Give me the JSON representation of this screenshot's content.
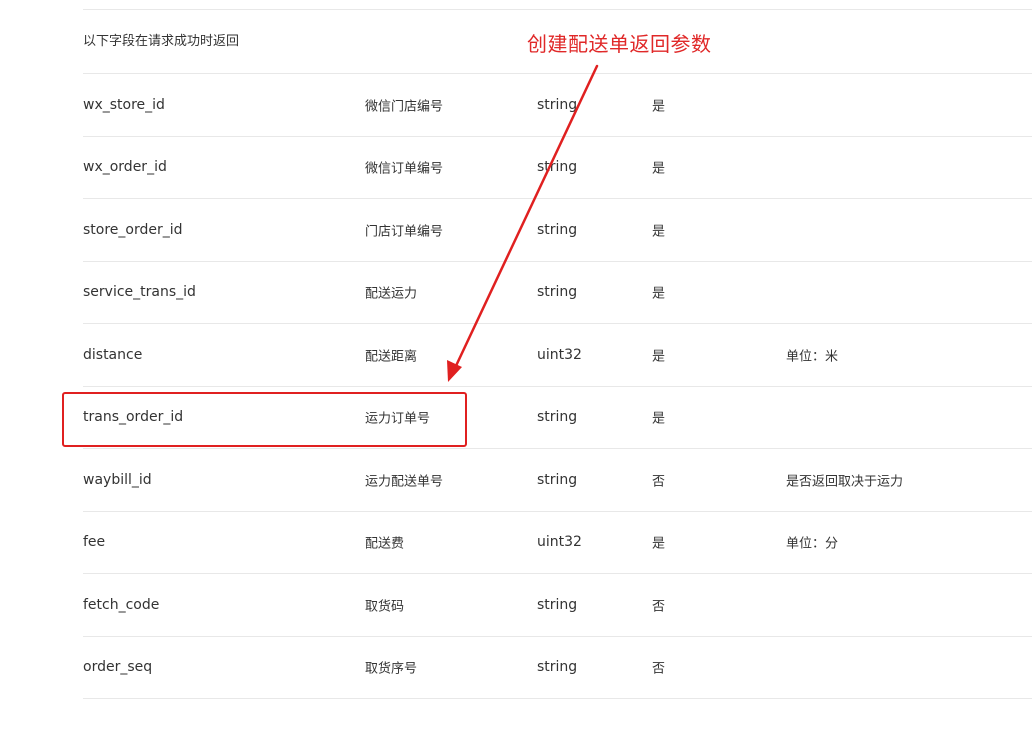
{
  "section": {
    "intro": "以下字段在请求成功时返回"
  },
  "annotation": {
    "title": "创建配送单返回参数",
    "color": "#e02020"
  },
  "rows": [
    {
      "name": "wx_store_id",
      "desc": "微信门店编号",
      "type": "string",
      "required": "是",
      "note": ""
    },
    {
      "name": "wx_order_id",
      "desc": "微信订单编号",
      "type": "string",
      "required": "是",
      "note": ""
    },
    {
      "name": "store_order_id",
      "desc": "门店订单编号",
      "type": "string",
      "required": "是",
      "note": ""
    },
    {
      "name": "service_trans_id",
      "desc": "配送运力",
      "type": "string",
      "required": "是",
      "note": ""
    },
    {
      "name": "distance",
      "desc": "配送距离",
      "type": "uint32",
      "required": "是",
      "note": "单位：米"
    },
    {
      "name": "trans_order_id",
      "desc": "运力订单号",
      "type": "string",
      "required": "是",
      "note": ""
    },
    {
      "name": "waybill_id",
      "desc": "运力配送单号",
      "type": "string",
      "required": "否",
      "note": "是否返回取决于运力"
    },
    {
      "name": "fee",
      "desc": "配送费",
      "type": "uint32",
      "required": "是",
      "note": "单位：分"
    },
    {
      "name": "fetch_code",
      "desc": "取货码",
      "type": "string",
      "required": "否",
      "note": ""
    },
    {
      "name": "order_seq",
      "desc": "取货序号",
      "type": "string",
      "required": "否",
      "note": ""
    }
  ]
}
